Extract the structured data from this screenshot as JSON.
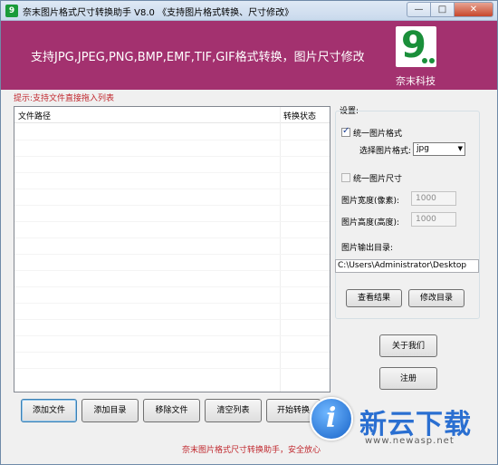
{
  "window": {
    "title": "奈末图片格式尺寸转换助手 V8.0   《支持图片格式转换、尺寸修改》",
    "controls": {
      "minimize": "—",
      "maximize": "□",
      "close": "✕"
    }
  },
  "banner": {
    "text": "支持JPG,JPEG,PNG,BMP,EMF,TIF,GIF格式转换，图片尺寸修改",
    "logo_digit": "9",
    "company": "奈末科技",
    "background_color": "#a3316f"
  },
  "hint": "提示:支持文件直接拖入列表",
  "file_list": {
    "columns": [
      "文件路径",
      "转换状态"
    ],
    "rows": []
  },
  "buttons": {
    "add_file": "添加文件",
    "add_folder": "添加目录",
    "remove_file": "移除文件",
    "clear_list": "清空列表",
    "start_convert": "开始转换",
    "view_result": "查看结果",
    "change_dir": "修改目录",
    "about": "关于我们",
    "register": "注册"
  },
  "settings": {
    "label": "设置:",
    "unify_format": {
      "label": "统一图片格式",
      "checked": true
    },
    "format_select": {
      "label": "选择图片格式:",
      "value": "jpg"
    },
    "unify_size": {
      "label": "统一图片尺寸",
      "checked": false
    },
    "width": {
      "label": "图片宽度(像素):",
      "value": "1000"
    },
    "height": {
      "label": "图片高度(高度):",
      "value": "1000"
    },
    "output_dir": {
      "label": "图片输出目录:",
      "value": "C:\\Users\\Administrator\\Desktop"
    }
  },
  "footer": "奈末图片格式尺寸转换助手，安全放心",
  "watermark": {
    "text": "新云下载",
    "url": "www.newasp.net"
  }
}
